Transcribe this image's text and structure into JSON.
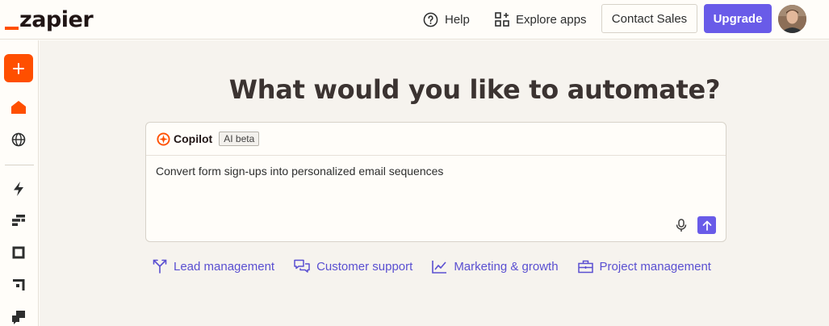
{
  "header": {
    "logo": "zapier",
    "help_label": "Help",
    "explore_label": "Explore apps",
    "contact_label": "Contact Sales",
    "upgrade_label": "Upgrade"
  },
  "sidebar": {
    "items": [
      {
        "icon": "plus-icon"
      },
      {
        "icon": "home-icon",
        "active": true
      },
      {
        "icon": "globe-icon"
      },
      {
        "icon": "zap-icon"
      },
      {
        "icon": "tables-icon"
      },
      {
        "icon": "interfaces-icon"
      },
      {
        "icon": "canvas-icon"
      },
      {
        "icon": "chatbot-icon"
      }
    ]
  },
  "main": {
    "headline": "What would you like to automate?",
    "copilot": {
      "name": "Copilot",
      "badge": "AI beta",
      "prompt": "Convert form sign-ups into personalized email sequences"
    },
    "suggestions": [
      {
        "label": "Lead management",
        "icon": "funnel-split-icon"
      },
      {
        "label": "Customer support",
        "icon": "chat-bubbles-icon"
      },
      {
        "label": "Marketing & growth",
        "icon": "line-chart-icon"
      },
      {
        "label": "Project management",
        "icon": "briefcase-icon"
      }
    ]
  },
  "colors": {
    "brand_orange": "#ff4f00",
    "accent_purple": "#695be8",
    "link_purple": "#5a4fd1",
    "background": "#f6f3ee"
  }
}
